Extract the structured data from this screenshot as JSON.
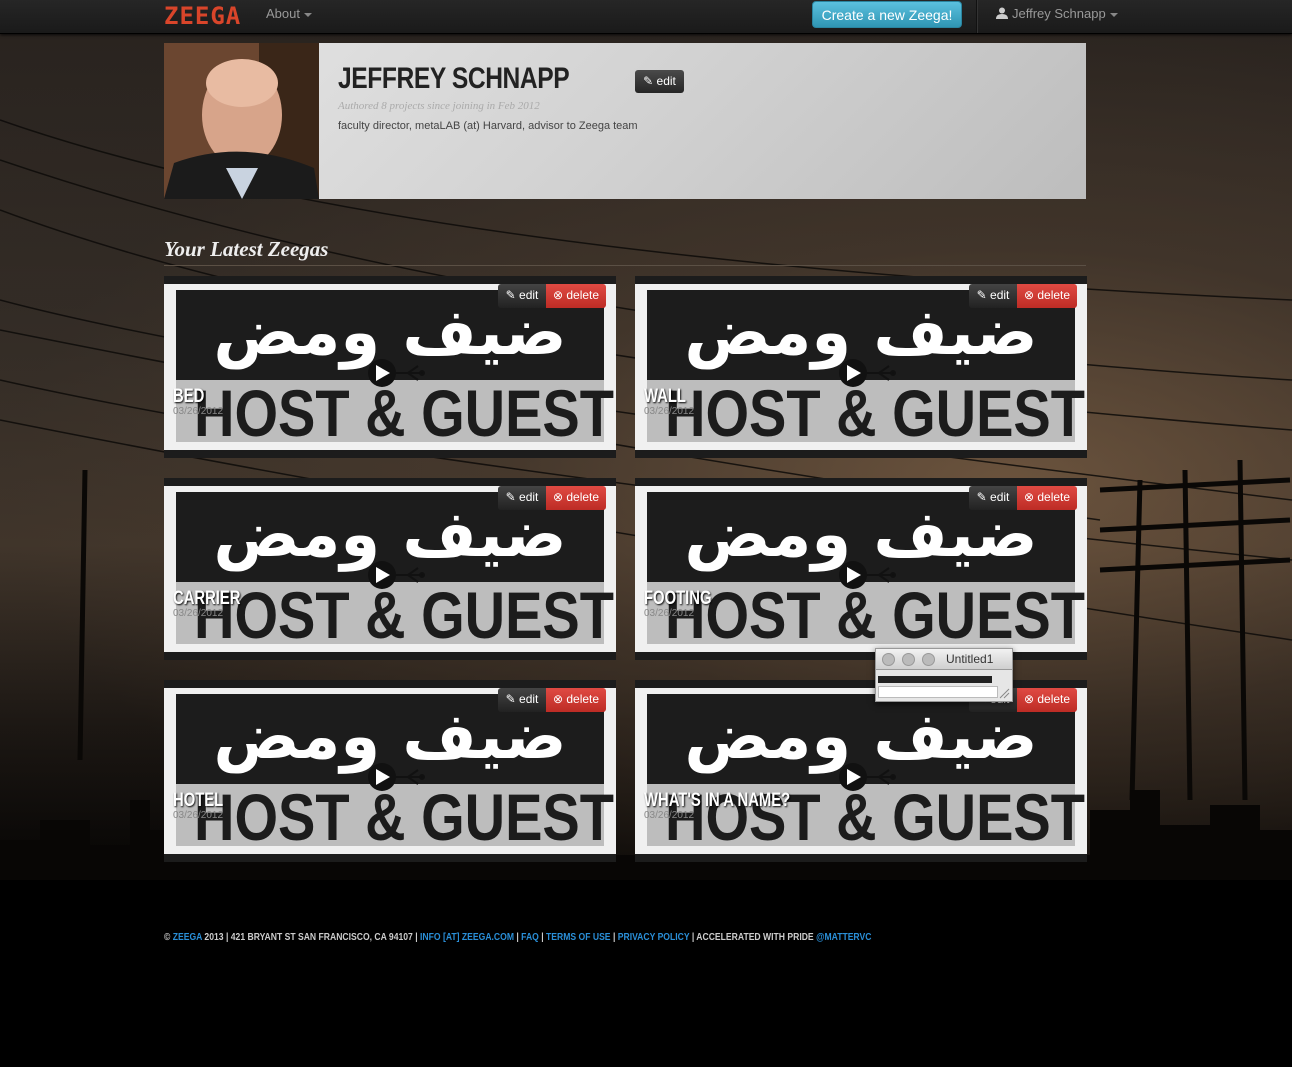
{
  "nav": {
    "logo": "ZEEGA",
    "about": "About",
    "create_button": "Create a new Zeega!",
    "user": "Jeffrey Schnapp"
  },
  "profile": {
    "name": "JEFFREY SCHNAPP",
    "edit": "edit",
    "meta": "Authored 8 projects since joining in Feb 2012",
    "bio": "faculty director, metaLAB (at) Harvard, advisor to Zeega team"
  },
  "section": {
    "title": "Your Latest Zeegas"
  },
  "cards": [
    {
      "title": "BED",
      "date": "03/26/2012",
      "edit": "edit",
      "delete": "delete"
    },
    {
      "title": "WALL",
      "date": "03/26/2012",
      "edit": "edit",
      "delete": "delete"
    },
    {
      "title": "CARRIER",
      "date": "03/26/2012",
      "edit": "edit",
      "delete": "delete"
    },
    {
      "title": "FOOTING",
      "date": "03/26/2012",
      "edit": "edit",
      "delete": "delete"
    },
    {
      "title": "HOTEL",
      "date": "03/26/2012",
      "edit": "edit",
      "delete": "delete"
    },
    {
      "title": "WHAT'S IN A NAME?",
      "date": "03/26/2012",
      "edit": "edit",
      "delete": "delete"
    }
  ],
  "card_art": {
    "arabic": "ضيف ومض",
    "english": "HOST & GUEST"
  },
  "mini_window": {
    "title": "Untitled1"
  },
  "footer": {
    "copyright": "© ",
    "zeega": "ZEEGA",
    "year_address": " 2013 | 421 BRYANT ST SAN FRANCISCO, CA 94107 | ",
    "email": "INFO [AT] ZEEGA.COM",
    "sep1": " | ",
    "faq": "FAQ",
    "sep2": " | ",
    "terms": "TERMS OF USE",
    "sep3": " | ",
    "privacy": "PRIVACY POLICY",
    "pride": " | ACCELERATED WITH PRIDE ",
    "matter": "@MATTERVC"
  },
  "colors": {
    "accent": "#5bc0de",
    "danger": "#d9403a",
    "logo": "#d9452a",
    "link": "#2a8fd8"
  }
}
